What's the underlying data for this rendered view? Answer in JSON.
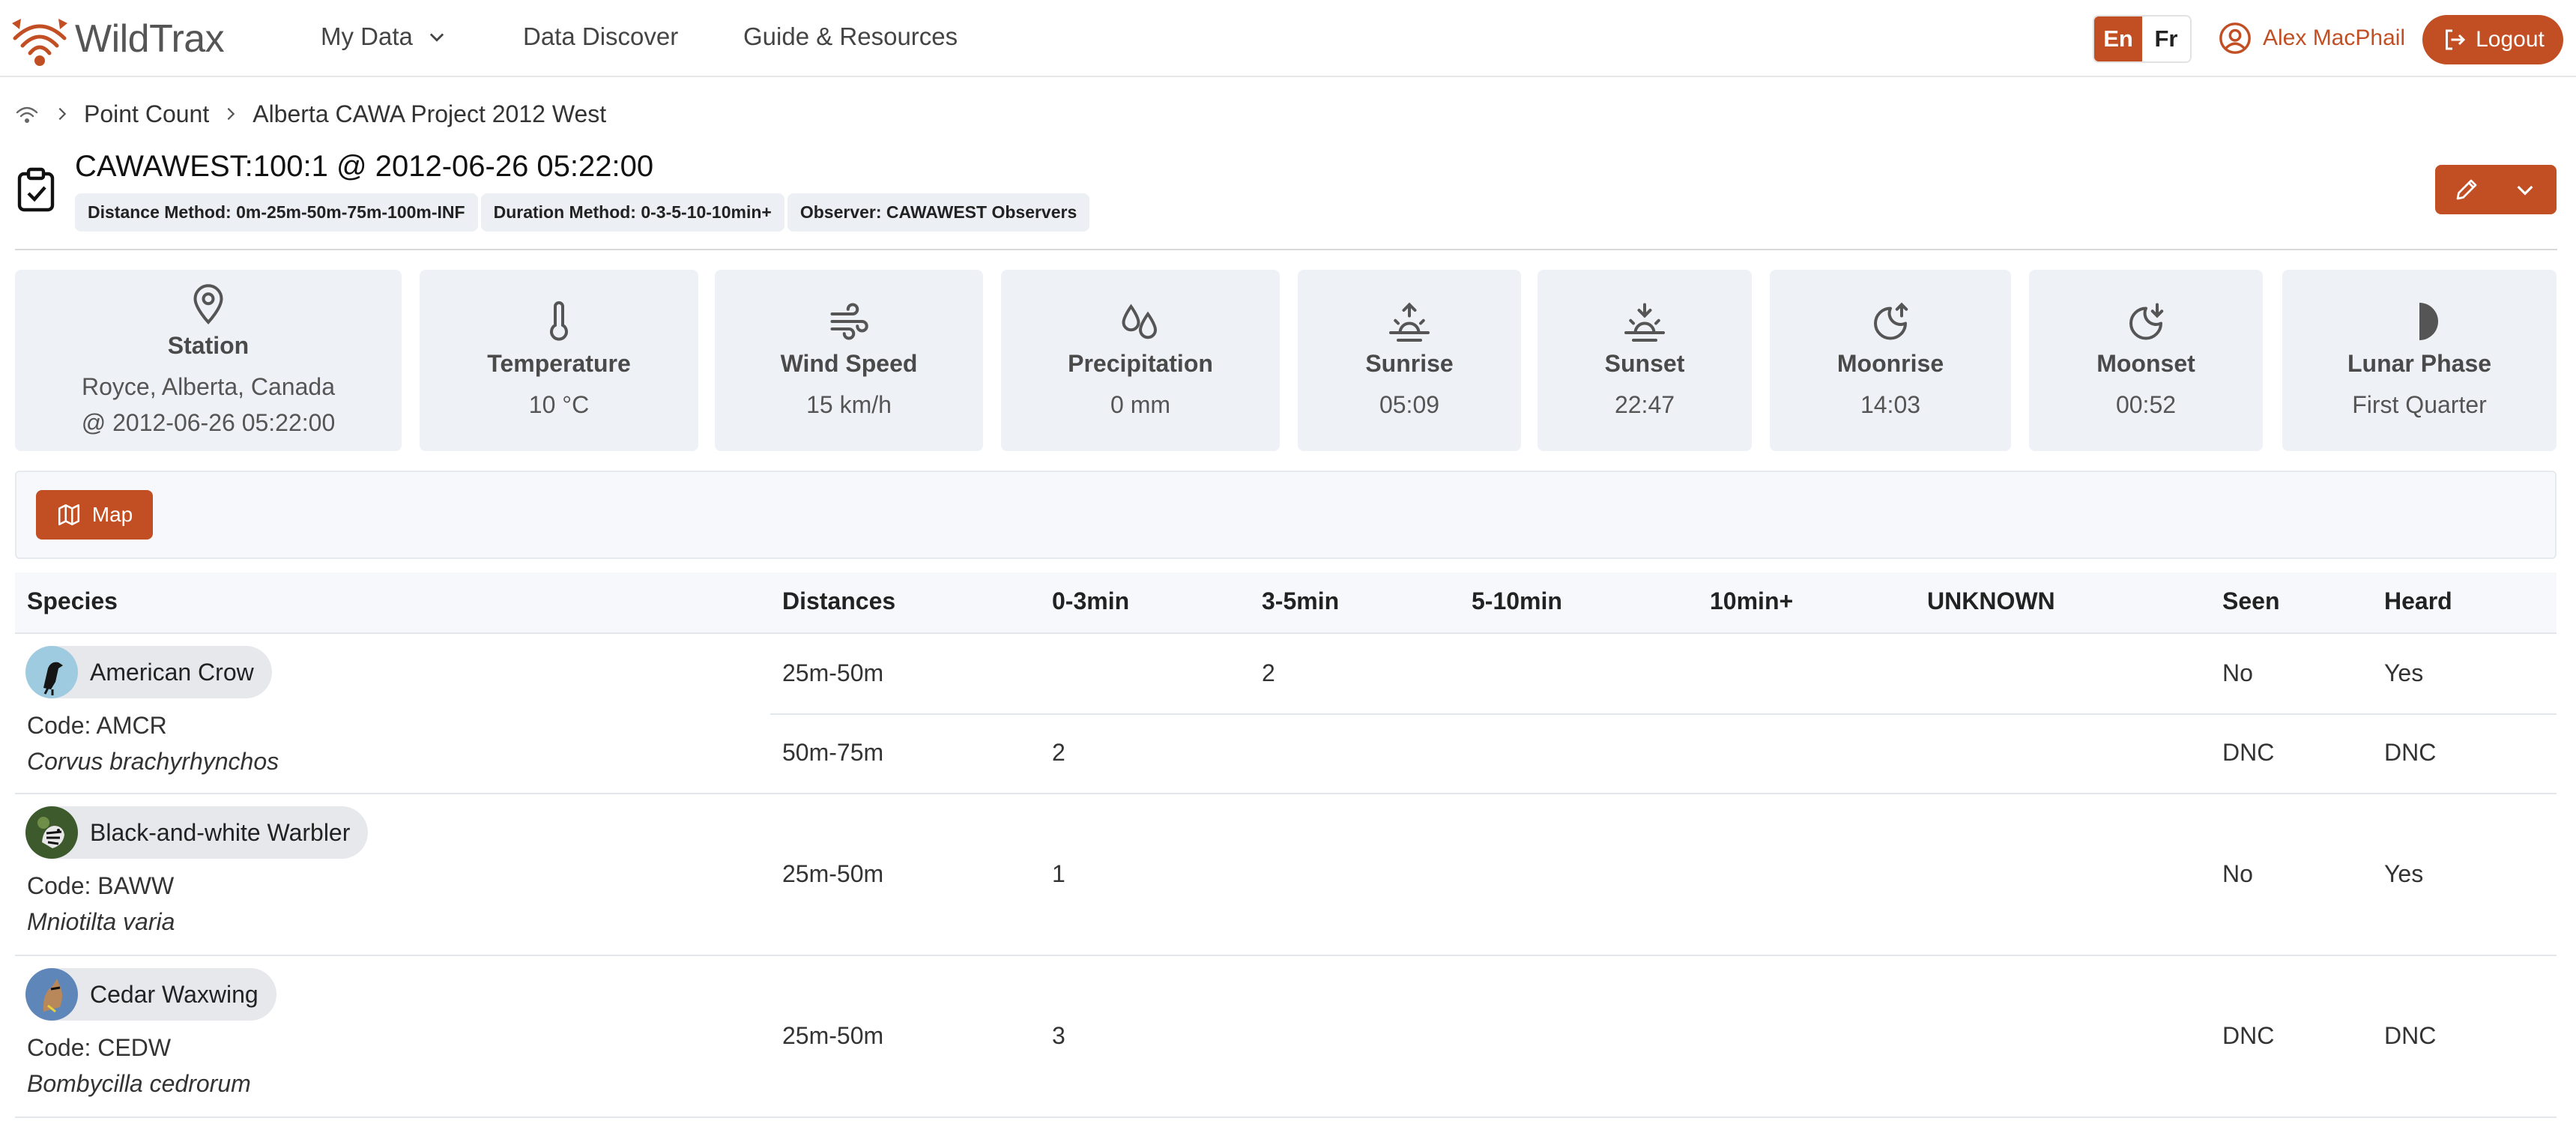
{
  "app": {
    "name": "WildTrax",
    "accent_color": "#c24f24",
    "nav": [
      "My Data",
      "Data Discover",
      "Guide & Resources"
    ],
    "lang": {
      "en": "En",
      "fr": "Fr",
      "active": "En"
    },
    "user": "Alex MacPhail",
    "logout": "Logout"
  },
  "breadcrumb": [
    "Point Count",
    "Alberta CAWA Project 2012 West"
  ],
  "header": {
    "title": "CAWAWEST:100:1 @ 2012-06-26 05:22:00",
    "chips": [
      "Distance Method: 0m-25m-50m-75m-100m-INF",
      "Duration Method: 0-3-5-10-10min+",
      "Observer: CAWAWEST Observers"
    ]
  },
  "info_cards": [
    {
      "icon": "map-pin-icon",
      "label": "Station",
      "lines": [
        "Royce, Alberta, Canada",
        "@ 2012-06-26 05:22:00"
      ]
    },
    {
      "icon": "thermometer-icon",
      "label": "Temperature",
      "lines": [
        "10 °C"
      ]
    },
    {
      "icon": "wind-icon",
      "label": "Wind Speed",
      "lines": [
        "15 km/h"
      ]
    },
    {
      "icon": "droplets-icon",
      "label": "Precipitation",
      "lines": [
        "0 mm"
      ]
    },
    {
      "icon": "sunrise-icon",
      "label": "Sunrise",
      "lines": [
        "05:09"
      ]
    },
    {
      "icon": "sunset-icon",
      "label": "Sunset",
      "lines": [
        "22:47"
      ]
    },
    {
      "icon": "moonrise-icon",
      "label": "Moonrise",
      "lines": [
        "14:03"
      ]
    },
    {
      "icon": "moonset-icon",
      "label": "Moonset",
      "lines": [
        "00:52"
      ]
    },
    {
      "icon": "half-moon-icon",
      "label": "Lunar Phase",
      "lines": [
        "First Quarter"
      ]
    }
  ],
  "map_button": "Map",
  "table": {
    "columns": [
      "Species",
      "Distances",
      "0-3min",
      "3-5min",
      "5-10min",
      "10min+",
      "UNKNOWN",
      "Seen",
      "Heard"
    ],
    "rows": [
      {
        "name": "American Crow",
        "code": "Code: AMCR",
        "scientific": "Corvus brachyrhynchos",
        "subrows": [
          {
            "distance": "25m-50m",
            "t0_3": "",
            "t3_5": "2",
            "t5_10": "",
            "t10p": "",
            "unknown": "",
            "seen": "No",
            "heard": "Yes"
          },
          {
            "distance": "50m-75m",
            "t0_3": "2",
            "t3_5": "",
            "t5_10": "",
            "t10p": "",
            "unknown": "",
            "seen": "DNC",
            "heard": "DNC"
          }
        ]
      },
      {
        "name": "Black-and-white Warbler",
        "code": "Code: BAWW",
        "scientific": "Mniotilta varia",
        "subrows": [
          {
            "distance": "25m-50m",
            "t0_3": "1",
            "t3_5": "",
            "t5_10": "",
            "t10p": "",
            "unknown": "",
            "seen": "No",
            "heard": "Yes"
          }
        ]
      },
      {
        "name": "Cedar Waxwing",
        "code": "Code: CEDW",
        "scientific": "Bombycilla cedrorum",
        "subrows": [
          {
            "distance": "25m-50m",
            "t0_3": "3",
            "t3_5": "",
            "t5_10": "",
            "t10p": "",
            "unknown": "",
            "seen": "DNC",
            "heard": "DNC"
          }
        ]
      }
    ]
  }
}
